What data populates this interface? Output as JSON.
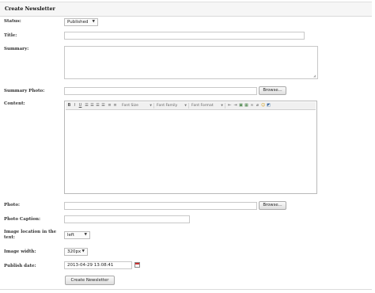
{
  "header": {
    "title": "Create Newsletter"
  },
  "fields": {
    "status": {
      "label": "Status:",
      "value": "Published"
    },
    "title": {
      "label": "Title:",
      "value": ""
    },
    "summary": {
      "label": "Summary:",
      "value": ""
    },
    "summary_photo": {
      "label": "Summary Photo:",
      "value": "",
      "button": "Browse..."
    },
    "content": {
      "label": "Content:",
      "toolbar": {
        "font_size": "Font Size",
        "font_family": "Font Family",
        "font_format": "Font Format",
        "icons": [
          "bold-icon",
          "italic-icon",
          "underline-icon",
          "align-left-icon",
          "align-center-icon",
          "align-right-icon",
          "align-justify-icon",
          "bullet-list-icon",
          "numbered-list-icon",
          "indent-icon",
          "outdent-icon",
          "image-icon",
          "table-icon",
          "link-icon",
          "unlink-icon",
          "emoticon-icon",
          "source-icon"
        ]
      },
      "value": ""
    },
    "photo": {
      "label": "Photo:",
      "value": "",
      "button": "Browse..."
    },
    "photo_caption": {
      "label": "Photo Caption:",
      "value": ""
    },
    "image_location": {
      "label": "Image location in the text:",
      "value": "left"
    },
    "image_width": {
      "label": "Image width:",
      "value": "320px"
    },
    "publish_date": {
      "label": "Publish date:",
      "value": "2013-04-29 13:08:41"
    }
  },
  "submit": {
    "label": "Create Newsletter"
  }
}
